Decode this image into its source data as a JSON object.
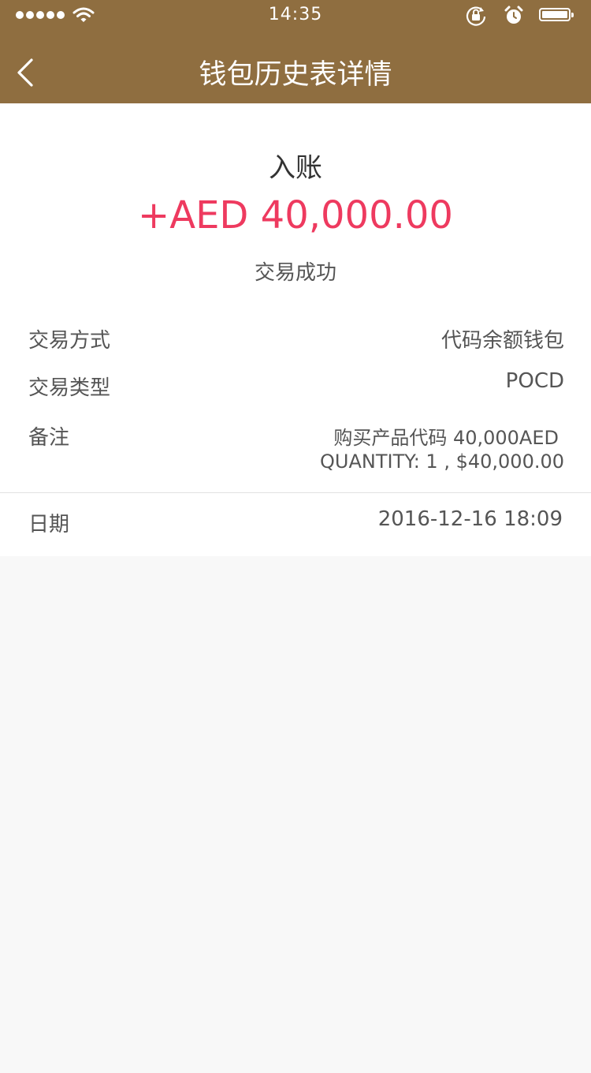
{
  "status_bar": {
    "time": "14:35",
    "icons": [
      "signal-dots-icon",
      "wifi-icon",
      "rotation-lock-icon",
      "alarm-icon",
      "battery-icon"
    ]
  },
  "nav": {
    "title": "钱包历史表详情",
    "back_icon": "chevron-left-icon"
  },
  "summary": {
    "entry_type": "入账",
    "amount": "+AED 40,000.00",
    "status": "交易成功"
  },
  "details": {
    "method_label": "交易方式",
    "method_value": "代码余额钱包",
    "type_label": "交易类型",
    "type_value": "POCD",
    "note_label": "备注",
    "note_line1": "购买产品代码 40,000AED",
    "note_line2": "QUANTITY: 1 , $40,000.00",
    "date_label": "日期",
    "date_value": "2016-12-16 18:09"
  },
  "colors": {
    "header_bg": "#8f6e40",
    "amount": "#ee3a5f",
    "page_bg": "#f8f8f8"
  }
}
